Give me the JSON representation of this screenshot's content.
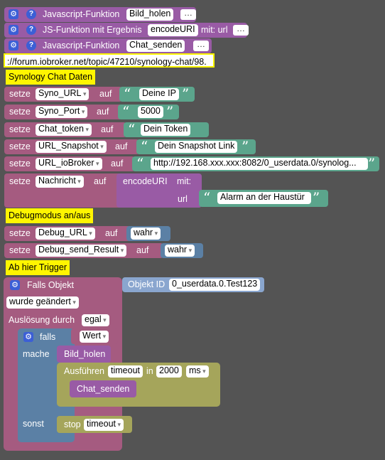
{
  "functions": [
    {
      "label": "Javascript-Funktion",
      "name": "Bild_holen"
    },
    {
      "label": "JS-Funktion mit Ergebnis",
      "name": "encodeURI",
      "params": "mit: url"
    },
    {
      "label": "Javascript-Funktion",
      "name": "Chat_senden"
    }
  ],
  "url_comment": "://forum.iobroker.net/topic/47210/synology-chat/98.",
  "section_synology": "Synology Chat Daten",
  "kw": {
    "setze": "setze",
    "auf": "auf",
    "mit": "mit:",
    "url": "url",
    "falls_objekt": "Falls Objekt",
    "objekt_id": "Objekt ID",
    "ausloesung": "Auslösung durch",
    "falls": "falls",
    "mache": "mache",
    "sonst": "sonst",
    "ausfuehren": "Ausführen",
    "in": "in",
    "stop": "stop"
  },
  "vars": [
    {
      "name": "Syno_URL",
      "value": "Deine IP"
    },
    {
      "name": "Syno_Port",
      "value": "5000"
    },
    {
      "name": "Chat_token",
      "value": "Dein Token"
    },
    {
      "name": "URL_Snapshot",
      "value": "Dein Snapshot Link"
    },
    {
      "name": "URL_ioBroker",
      "value": "http://192.168.xxx.xxx:8082/0_userdata.0/synolog..."
    }
  ],
  "nachricht": {
    "name": "Nachricht",
    "func": "encodeURI",
    "value": "Alarm an der  Haustür"
  },
  "section_debug": "Debugmodus an/aus",
  "debug": [
    {
      "name": "Debug_URL",
      "value": "wahr"
    },
    {
      "name": "Debug_send_Result",
      "value": "wahr"
    }
  ],
  "section_trigger": "Ab hier Trigger",
  "trigger": {
    "object_id": "0_userdata.0.Test123",
    "event": "wurde geändert",
    "by": "egal",
    "cond": "Wert",
    "call1": "Bild_holen",
    "timeout_var": "timeout",
    "delay": "2000",
    "unit": "ms",
    "call2": "Chat_senden",
    "stop_var": "timeout"
  },
  "colors": {
    "procedure": "#995ba5",
    "variable": "#a55b80",
    "text": "#5ba58c",
    "logic": "#5b80a5",
    "control": "#a5a55b",
    "comment": "#fff500",
    "workspace": "#545454"
  },
  "icons": [
    "gear-icon",
    "help-icon",
    "quote-icon"
  ]
}
